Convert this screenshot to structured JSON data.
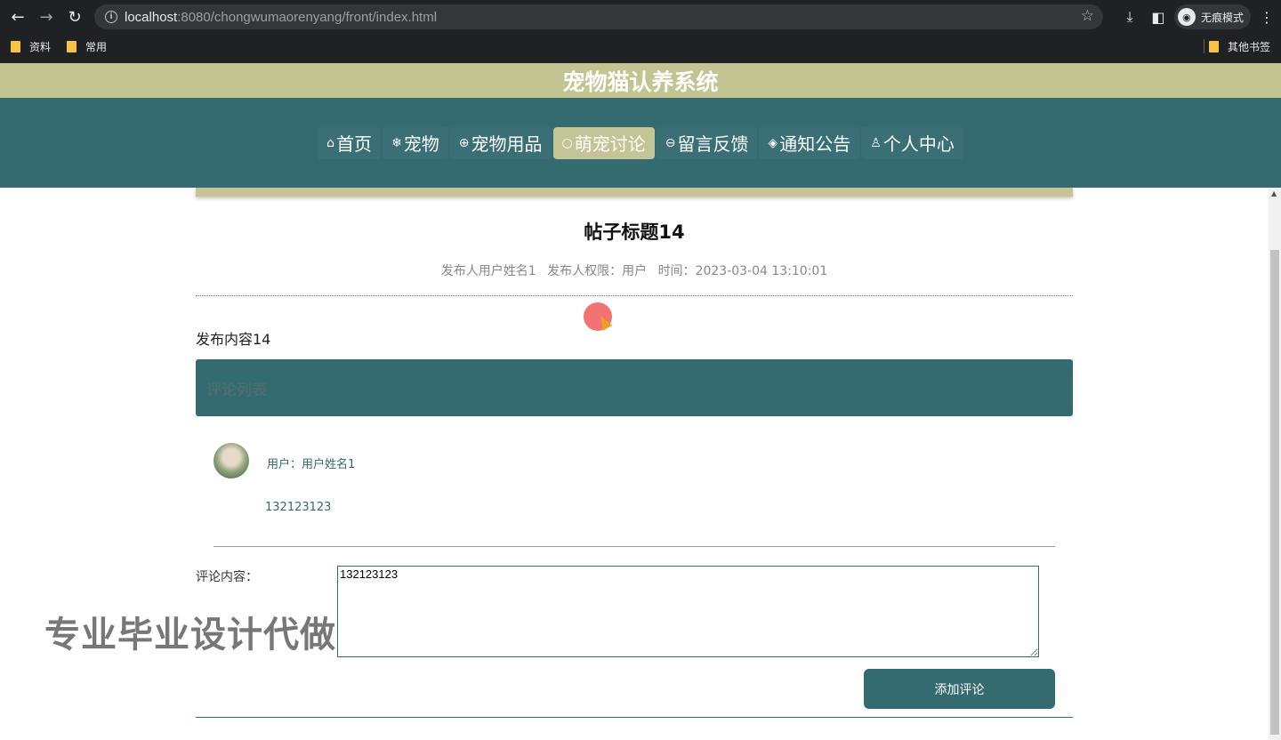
{
  "browser": {
    "url_host": "localhost",
    "url_rest": ":8080/chongwumaorenyang/front/index.html",
    "incognito_label": "无痕模式",
    "bookmarks": [
      "资料",
      "常用"
    ],
    "other_bookmarks": "其他书签"
  },
  "site": {
    "title": "宠物猫认养系统"
  },
  "nav": {
    "items": [
      {
        "icon": "⌂",
        "label": "首页",
        "active": false
      },
      {
        "icon": "❄",
        "label": "宠物",
        "active": false
      },
      {
        "icon": "⊕",
        "label": "宠物用品",
        "active": false
      },
      {
        "icon": "○",
        "label": "萌宠讨论",
        "active": true
      },
      {
        "icon": "⊖",
        "label": "留言反馈",
        "active": false
      },
      {
        "icon": "◈",
        "label": "通知公告",
        "active": false
      },
      {
        "icon": "♙",
        "label": "个人中心",
        "active": false
      }
    ]
  },
  "post": {
    "title": "帖子标题14",
    "author": "发布人用户姓名1",
    "role": "发布人权限：用户",
    "time": "时间：2023-03-04 13:10:01",
    "content": "发布内容14"
  },
  "comments": {
    "header": "评论列表",
    "items": [
      {
        "user": "用户：用户姓名1",
        "text": "132123123"
      }
    ]
  },
  "form": {
    "label": "评论内容：",
    "value": "132123123",
    "submit": "添加评论"
  },
  "watermark": "专业毕业设计代做"
}
